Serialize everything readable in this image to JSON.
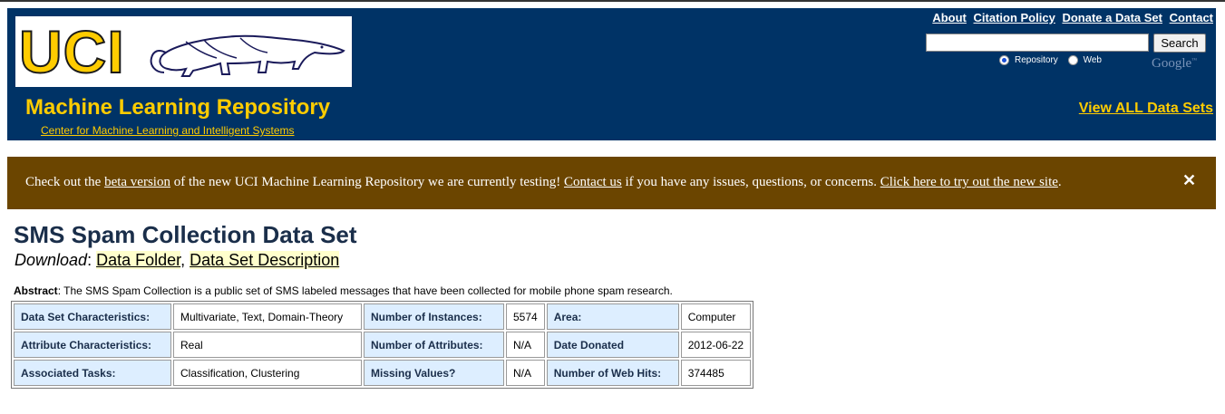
{
  "header": {
    "logo_text": "UCI",
    "repo_title": "Machine Learning Repository",
    "center_link": "Center for Machine Learning and Intelligent Systems",
    "top_links": [
      "About",
      "Citation Policy",
      "Donate a Data Set",
      "Contact"
    ],
    "search": {
      "value": "",
      "button": "Search"
    },
    "radio": {
      "repository": "Repository",
      "web": "Web",
      "selected": "Repository"
    },
    "google_logo": "Google",
    "view_all": "View ALL Data Sets",
    "colors": {
      "background": "#003366",
      "accent": "#ffcc00"
    }
  },
  "banner": {
    "t1": "Check out the ",
    "link1": "beta version",
    "t2": " of the new UCI Machine Learning Repository we are currently testing! ",
    "link2": "Contact us",
    "t3": " if you have any issues, questions, or concerns. ",
    "link3": "Click here to try out the new site",
    "t4": ".",
    "close": "✕",
    "color": "#6b4500"
  },
  "main": {
    "title": "SMS Spam Collection Data Set",
    "download_label": "Download",
    "download_sep": ": ",
    "link_folder": "Data Folder",
    "link_comma": ", ",
    "link_description": "Data Set Description",
    "abstract_label": "Abstract",
    "abstract_text": ": The SMS Spam Collection is a public set of SMS labeled messages that have been collected for mobile phone spam research."
  },
  "table": {
    "rows": [
      [
        "Data Set Characteristics:",
        "Multivariate, Text, Domain-Theory",
        "Number of Instances:",
        "5574",
        "Area:",
        "Computer"
      ],
      [
        "Attribute Characteristics:",
        "Real",
        "Number of Attributes:",
        "N/A",
        "Date Donated",
        "2012-06-22"
      ],
      [
        "Associated Tasks:",
        "Classification, Clustering",
        "Missing Values?",
        "N/A",
        "Number of Web Hits:",
        "374485"
      ]
    ]
  }
}
